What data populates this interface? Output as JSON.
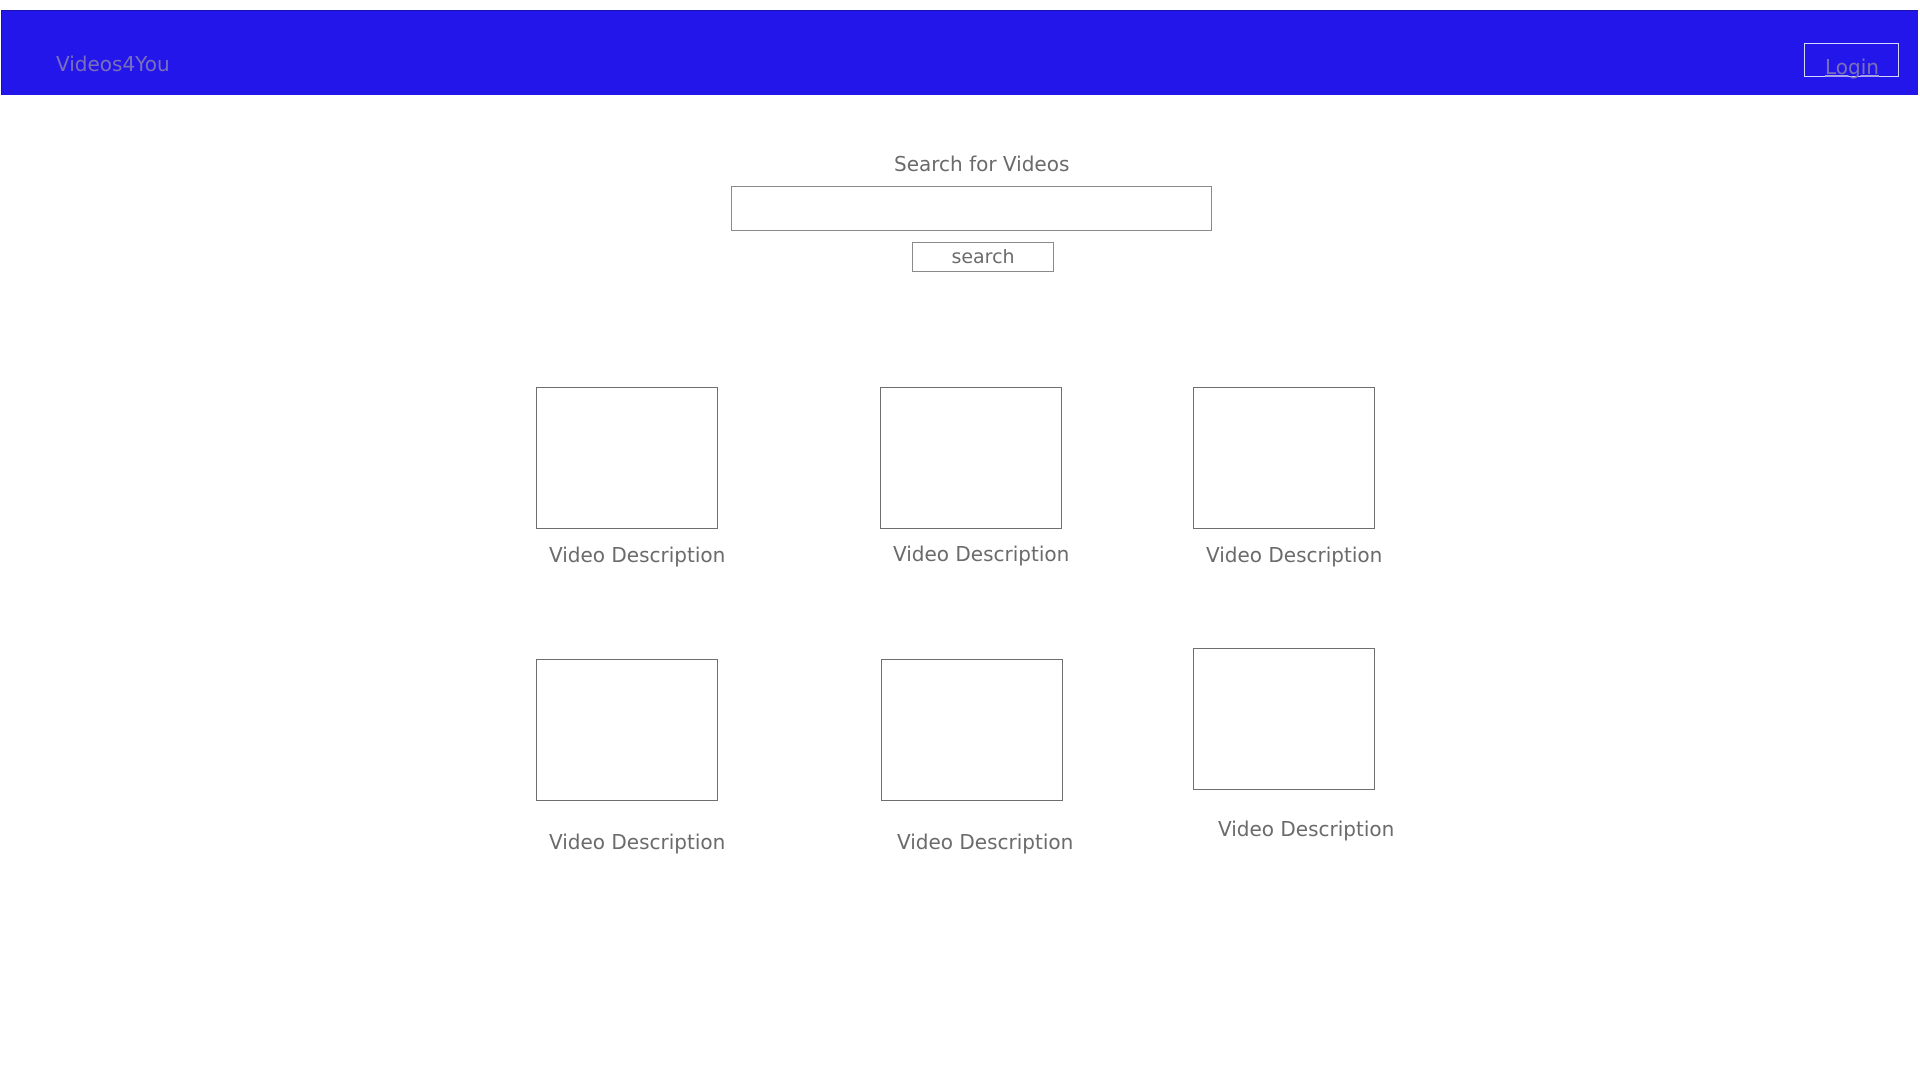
{
  "header": {
    "brand": "Videos4You",
    "login_label": "Login",
    "background_color": "#2316ea"
  },
  "search": {
    "label": "Search for Videos",
    "value": "",
    "placeholder": "",
    "button_label": "search"
  },
  "videos": [
    {
      "description": "Video Description"
    },
    {
      "description": "Video Description"
    },
    {
      "description": "Video Description"
    },
    {
      "description": "Video Description"
    },
    {
      "description": "Video Description"
    },
    {
      "description": "Video Description"
    }
  ]
}
